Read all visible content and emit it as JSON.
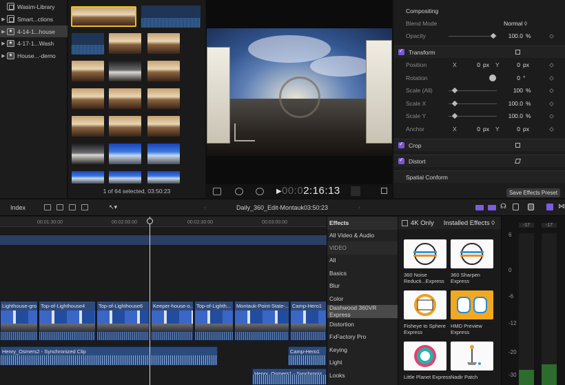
{
  "library": {
    "items": [
      {
        "label": "Wasim-Library",
        "icon": "library-icon",
        "expand": "",
        "selected": false
      },
      {
        "label": "Smart...ctions",
        "icon": "folder-icon",
        "expand": "▶",
        "selected": false
      },
      {
        "label": "4-14-1...house",
        "icon": "event-star-icon",
        "expand": "▶",
        "selected": true
      },
      {
        "label": "4-17-1...Wash",
        "icon": "event-star-icon",
        "expand": "▶",
        "selected": false
      },
      {
        "label": "House...-demo",
        "icon": "event-star-icon",
        "expand": "▶",
        "selected": false
      }
    ]
  },
  "browser": {
    "status": "1 of 64 selected, 03:50:23"
  },
  "viewer": {
    "timecode_dim": "00:0",
    "timecode": "2:16:13"
  },
  "inspector": {
    "compositing": "Compositing",
    "blend_mode_label": "Blend Mode",
    "blend_mode_value": "Normal ◊",
    "opacity_label": "Opacity",
    "opacity_value": "100.0",
    "opacity_unit": "%",
    "transform": "Transform",
    "position_label": "Position",
    "position_x_label": "X",
    "position_x": "0",
    "position_x_unit": "px",
    "position_y_label": "Y",
    "position_y": "0",
    "position_y_unit": "px",
    "rotation_label": "Rotation",
    "rotation_value": "0",
    "rotation_unit": "°",
    "scale_all_label": "Scale (All)",
    "scale_all_value": "100",
    "scale_all_unit": "%",
    "scale_x_label": "Scale X",
    "scale_x_value": "100.0",
    "scale_x_unit": "%",
    "scale_y_label": "Scale Y",
    "scale_y_value": "100.0",
    "scale_y_unit": "%",
    "anchor_label": "Anchor",
    "anchor_x_label": "X",
    "anchor_x": "0",
    "anchor_x_unit": "px",
    "anchor_y_label": "Y",
    "anchor_y": "0",
    "anchor_y_unit": "px",
    "crop": "Crop",
    "distort": "Distort",
    "spatial_conform": "Spatial Conform",
    "save_preset": "Save Effects Preset"
  },
  "toolbar": {
    "index": "Index",
    "project_name": "Daily_360_Edit-Montauk",
    "project_duration": "03:50:23"
  },
  "timeline": {
    "ruler": [
      "00:01:30:00",
      "00:02:00:00",
      "00:02:30:00",
      "00:03:00:00"
    ],
    "clips": [
      "Lighthouse-gro...",
      "Top-of-Lighthouse4",
      "Top-of-Lighthouse6",
      "Keeper-house-o...",
      "Top-of-Lighth...",
      "Montauk-Point-State-...",
      "Camp-Hero1"
    ],
    "audio_clips": [
      "Henry_Osmers2 - Synchronized Clip",
      "Camp-Hero1",
      "Henry_Osmers1 - Synchroniz..."
    ]
  },
  "effects": {
    "header": "Effects",
    "categories": [
      "All Video & Audio",
      "VIDEO",
      "All",
      "Basics",
      "Blur",
      "Color",
      "Dashwood 360VR Express",
      "Distortion",
      "FxFactory Pro",
      "Keying",
      "Light",
      "Looks"
    ],
    "selected_category": "Dashwood 360VR Express",
    "four_k_only": "4K Only",
    "installed": "Installed Effects ◊",
    "items": [
      "360 Noise Reducti...Express",
      "360 Sharpen Express",
      "Fisheye to Sphere Express",
      "HMD Preview Express",
      "Little Planet Express",
      "Nadir Patch"
    ]
  },
  "meters": {
    "peak_left": "-17",
    "peak_right": "-17",
    "scale": [
      "6",
      "0",
      "-6",
      "-12",
      "-20",
      "-30"
    ]
  },
  "colors": {
    "accent_purple": "#7b55d8",
    "selection_yellow": "#f0c020",
    "clip_blue": "#2f4a7a"
  }
}
